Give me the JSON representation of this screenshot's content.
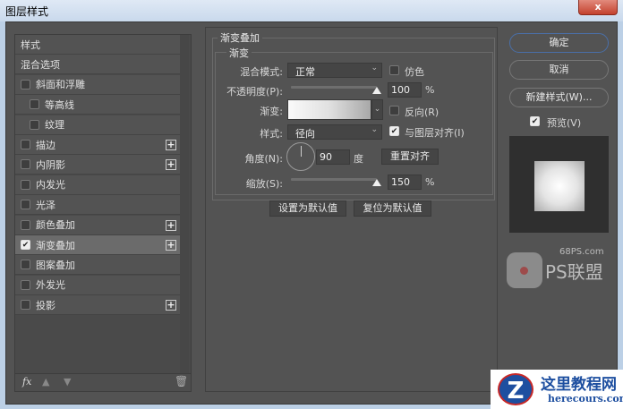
{
  "window": {
    "title": "图层样式",
    "close": "x"
  },
  "sidebar": {
    "items": [
      {
        "label": "样式",
        "checkbox": false,
        "plus": false,
        "indent": 0
      },
      {
        "label": "混合选项",
        "checkbox": false,
        "plus": false,
        "indent": 0
      },
      {
        "label": "斜面和浮雕",
        "checkbox": true,
        "checked": false,
        "plus": false,
        "indent": 0
      },
      {
        "label": "等高线",
        "checkbox": true,
        "checked": false,
        "plus": false,
        "indent": 1
      },
      {
        "label": "纹理",
        "checkbox": true,
        "checked": false,
        "plus": false,
        "indent": 1
      },
      {
        "label": "描边",
        "checkbox": true,
        "checked": false,
        "plus": true,
        "indent": 0
      },
      {
        "label": "内阴影",
        "checkbox": true,
        "checked": false,
        "plus": true,
        "indent": 0
      },
      {
        "label": "内发光",
        "checkbox": true,
        "checked": false,
        "plus": false,
        "indent": 0
      },
      {
        "label": "光泽",
        "checkbox": true,
        "checked": false,
        "plus": false,
        "indent": 0
      },
      {
        "label": "颜色叠加",
        "checkbox": true,
        "checked": false,
        "plus": true,
        "indent": 0
      },
      {
        "label": "渐变叠加",
        "checkbox": true,
        "checked": true,
        "plus": true,
        "indent": 0,
        "selected": true
      },
      {
        "label": "图案叠加",
        "checkbox": true,
        "checked": false,
        "plus": false,
        "indent": 0
      },
      {
        "label": "外发光",
        "checkbox": true,
        "checked": false,
        "plus": false,
        "indent": 0
      },
      {
        "label": "投影",
        "checkbox": true,
        "checked": false,
        "plus": true,
        "indent": 0
      }
    ],
    "footer": {
      "fx": "fx"
    }
  },
  "panel": {
    "title": "渐变叠加",
    "subtitle": "渐变",
    "blend_label": "混合模式:",
    "blend_value": "正常",
    "dither_label": "仿色",
    "dither": false,
    "opacity_label": "不透明度(P):",
    "opacity_value": "100",
    "opacity_unit": "%",
    "opacity": 100,
    "gradient_label": "渐变:",
    "reverse_label": "反向(R)",
    "reverse": false,
    "style_label": "样式:",
    "style_value": "径向",
    "align_label": "与图层对齐(I)",
    "align": true,
    "angle_label": "角度(N):",
    "angle_value": "90",
    "angle_unit": "度",
    "reset_align": "重置对齐",
    "scale_label": "缩放(S):",
    "scale_value": "150",
    "scale_unit": "%",
    "scale": 150,
    "set_default": "设置为默认值",
    "reset_default": "复位为默认值"
  },
  "actions": {
    "ok": "确定",
    "cancel": "取消",
    "new_style": "新建样式(W)...",
    "preview_label": "预览(V)",
    "preview": true
  },
  "watermarks": {
    "ps_site": "68PS.com",
    "ps_name": "PS联盟",
    "site_name": "这里教程网",
    "site_url": "herecours.com"
  }
}
